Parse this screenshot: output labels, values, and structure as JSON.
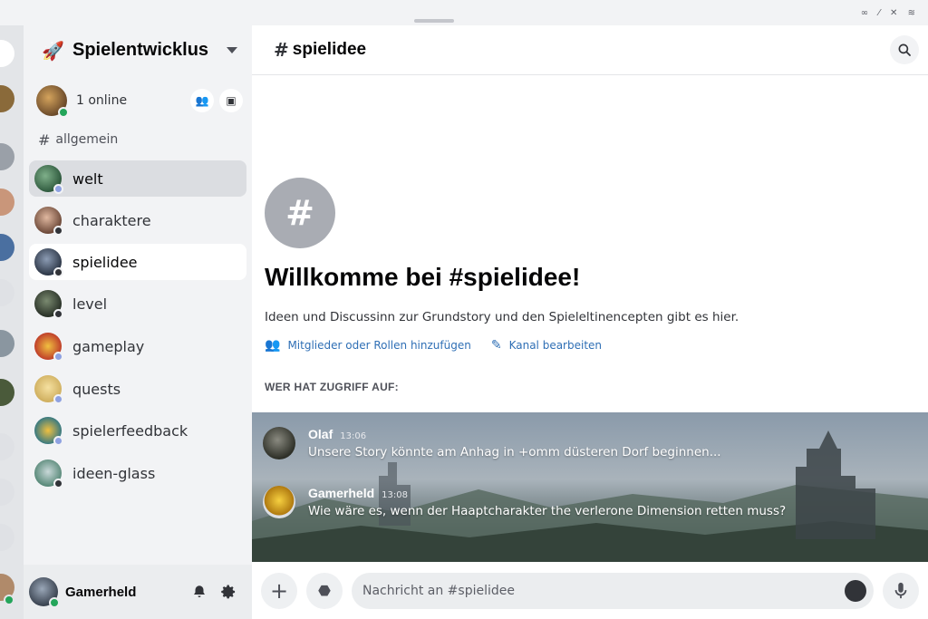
{
  "server": {
    "name": "Spielentwicklus",
    "icon": "rocket-icon"
  },
  "online": {
    "label": "1 online"
  },
  "category": {
    "name": "allgemein"
  },
  "channels": [
    {
      "name": "welt",
      "state": "active"
    },
    {
      "name": "charaktere",
      "state": "normal"
    },
    {
      "name": "spielidee",
      "state": "selected"
    },
    {
      "name": "level",
      "state": "normal"
    },
    {
      "name": "gameplay",
      "state": "normal"
    },
    {
      "name": "quests",
      "state": "normal"
    },
    {
      "name": "spielerfeedback",
      "state": "normal"
    },
    {
      "name": "ideen-glass",
      "state": "normal"
    }
  ],
  "user": {
    "name": "Gamerheld",
    "status": "online"
  },
  "header": {
    "channel": "spielidee"
  },
  "welcome": {
    "title": "Willkomme bei #spielidee!",
    "description": "Ideen und Discussinn zur Grundstory und den Spieleltinencepten gibt es hier.",
    "action_members": "Mitglieder oder Rollen hinzufügen",
    "action_edit": "Kanal bearbeiten",
    "access_label": "WER HAT ZUGRIFF AUF:"
  },
  "messages": [
    {
      "author": "Olaf",
      "time": "13:06",
      "text": "Unsere Story könnte am Anhag in +omm düsteren Dorf beginnen..."
    },
    {
      "author": "Gamerheld",
      "time": "13:08",
      "text": "Wie wäre es, wenn der Haaptcharakter the verlerone Dimension retten muss?"
    }
  ],
  "composer": {
    "placeholder": "Nachricht an #spielidee"
  },
  "colors": {
    "accent": "#2f6fb5",
    "online": "#23a55a",
    "sidebar_bg": "#f2f3f5",
    "main_bg": "#ffffff"
  }
}
